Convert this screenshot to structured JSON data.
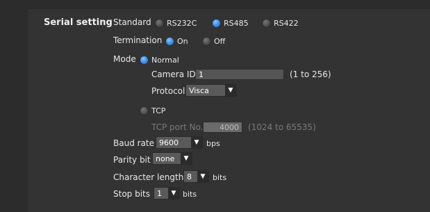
{
  "serial": {
    "section_title": "Serial setting",
    "standard": {
      "label": "Standard",
      "options": [
        "RS232C",
        "RS485",
        "RS422"
      ]
    },
    "termination": {
      "label": "Termination",
      "options": [
        "On",
        "Off"
      ]
    },
    "mode": {
      "label": "Mode",
      "normal": {
        "label": "Normal",
        "camera_id_label": "Camera ID",
        "camera_id_value": "1",
        "camera_id_range": "(1 to 256)",
        "protocol_label": "Protocol",
        "protocol_value": "Visca"
      },
      "tcp": {
        "label": "TCP",
        "port_label": "TCP port No.",
        "port_value": "4000",
        "port_range": "(1024 to 65535)"
      }
    },
    "baud_rate": {
      "label": "Baud rate",
      "value": "9600",
      "unit": "bps"
    },
    "parity_bit": {
      "label": "Parity bit",
      "value": "none"
    },
    "character_length": {
      "label": "Character length",
      "value": "8",
      "unit": "bits"
    },
    "stop_bits": {
      "label": "Stop bits",
      "value": "1",
      "unit": "bits"
    }
  },
  "icons": {
    "dropdown_arrow": "▼"
  },
  "colors": {
    "radio_selected": "#3f8fe6",
    "radio_unselected": "#4a4a4a",
    "background": "#333333"
  }
}
